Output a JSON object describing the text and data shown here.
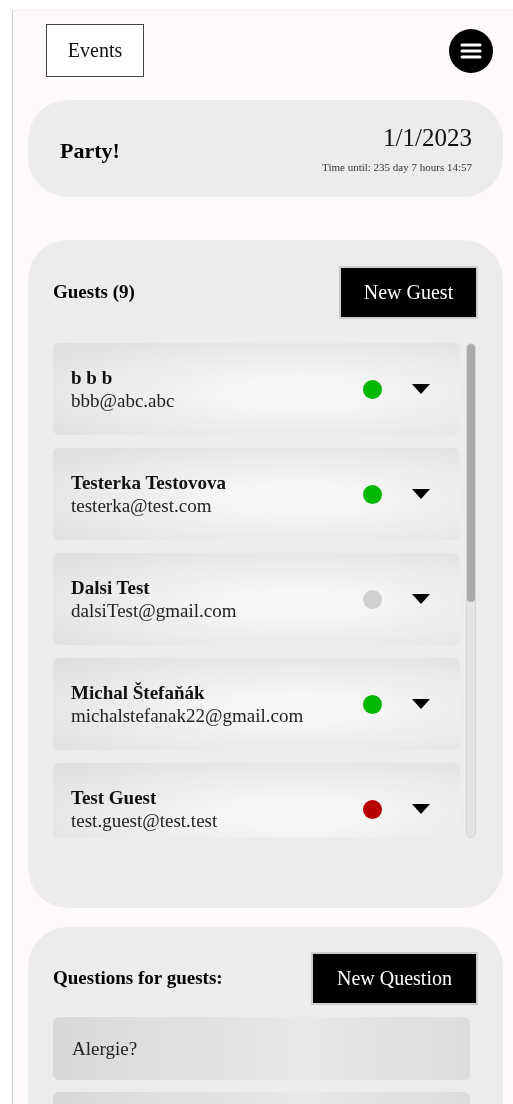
{
  "header": {
    "events_button": "Events"
  },
  "event": {
    "title": "Party!",
    "date": "1/1/2023",
    "countdown": "Time until: 235 day 7 hours 14:57"
  },
  "guests": {
    "title": "Guests (9)",
    "new_button": "New Guest",
    "items": [
      {
        "name": "b b b",
        "email": "bbb@abc.abc",
        "color": "#00b800"
      },
      {
        "name": "Testerka Testovova",
        "email": "testerka@test.com",
        "color": "#00b800"
      },
      {
        "name": "Dalsi Test",
        "email": "dalsiTest@gmail.com",
        "color": "#d0d0d0"
      },
      {
        "name": "Michal Štefaňák",
        "email": "michalstefanak22@gmail.com",
        "color": "#00b800"
      },
      {
        "name": "Test Guest",
        "email": "test.guest@test.test",
        "color": "#b80000"
      }
    ]
  },
  "questions": {
    "title": "Questions for guests:",
    "new_button": "New Question",
    "items": [
      {
        "text": "Alergie?"
      }
    ]
  }
}
